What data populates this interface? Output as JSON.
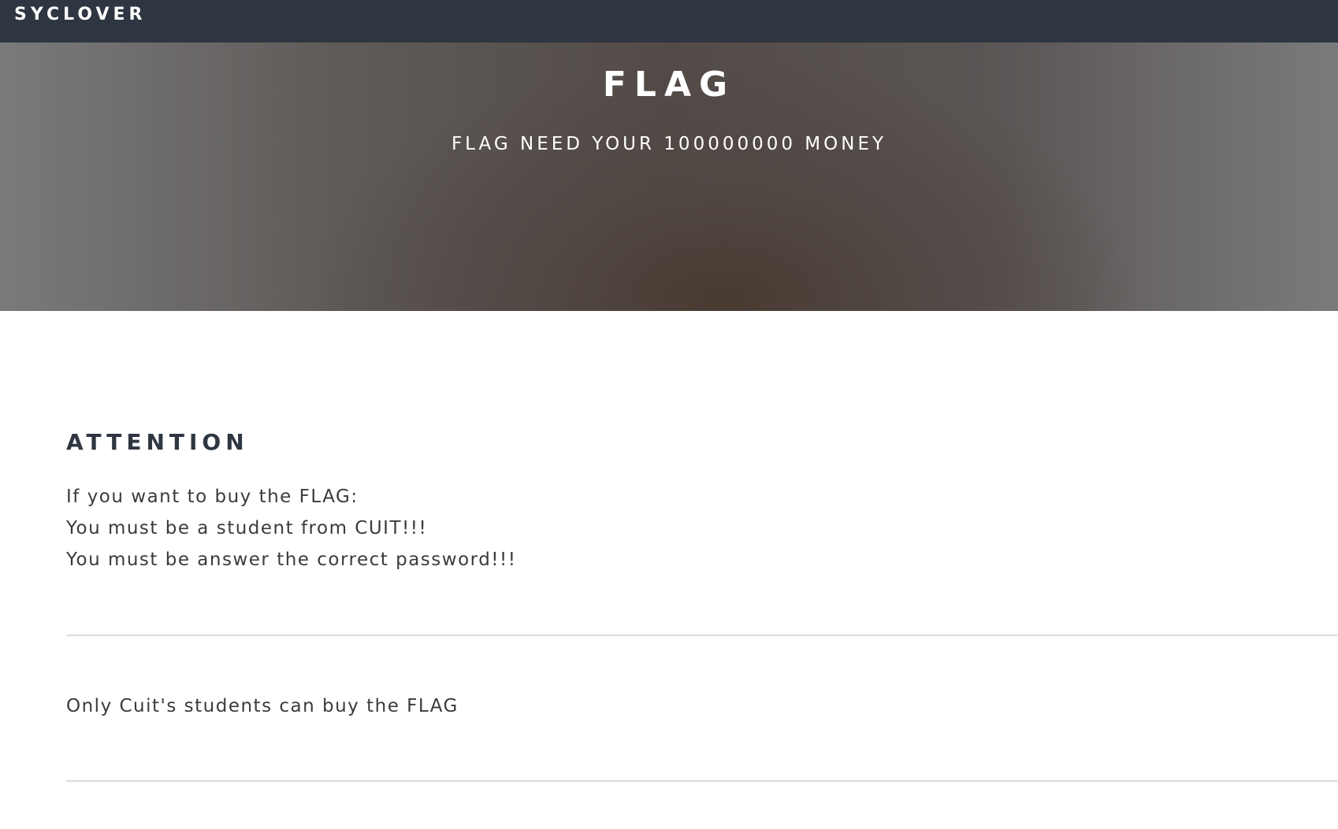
{
  "navbar": {
    "brand": "SYCLOVER"
  },
  "hero": {
    "title": "FLAG",
    "subtitle": "FLAG NEED YOUR 100000000 MONEY"
  },
  "attention": {
    "heading": "ATTENTION",
    "lines": [
      "If you want to buy the FLAG:",
      "You must be a student from CUIT!!!",
      "You must be answer the correct password!!!"
    ]
  },
  "status": {
    "message": "Only Cuit's students can buy the FLAG"
  },
  "colors": {
    "navbar_bg": "#2e3641",
    "heading_text": "#2e3641",
    "body_text": "#3b3b3f",
    "divider": "#dcdcdc"
  }
}
